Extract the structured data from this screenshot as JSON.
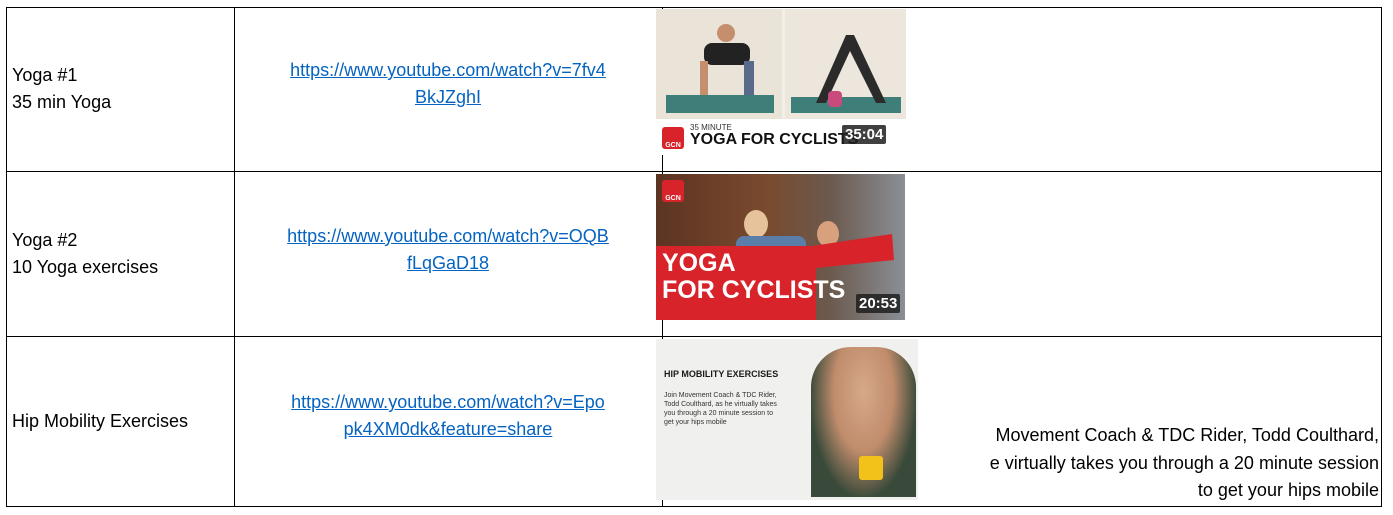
{
  "rows": [
    {
      "name_lines": [
        "Yoga #1",
        "35 min Yoga"
      ],
      "url_line1": "https://www.youtube.com/watch?v=7fv4",
      "url_line2": "BkJZghI",
      "thumbnail": {
        "logo": "GCN",
        "caption_small": "35 MINUTE",
        "caption_big": "YOGA FOR CYCLISTS",
        "duration": "35:04"
      },
      "description_lines": []
    },
    {
      "name_lines": [
        "Yoga #2",
        "10 Yoga exercises"
      ],
      "url_line1": "https://www.youtube.com/watch?v=OQB",
      "url_line2": "fLqGaD18",
      "thumbnail": {
        "logo": "GCN",
        "title_line1": "YOGA",
        "title_line2": "FOR CYCLISTS",
        "duration": "20:53"
      },
      "description_lines": []
    },
    {
      "name_lines": [
        "Hip Mobility Exercises"
      ],
      "url_line1": "https://www.youtube.com/watch?v=Epo",
      "url_line2": "pk4XM0dk&feature=share",
      "thumbnail": {
        "heading": "HIP MOBILITY EXERCISES",
        "body": "Join Movement Coach & TDC Rider, Todd Coulthard, as he virtually takes you through a 20 minute session to get your hips mobile"
      },
      "description_lines": [
        "Movement Coach & TDC Rider, Todd Coulthard,",
        "e virtually takes you through a 20 minute session",
        "to get your hips mobile"
      ]
    }
  ]
}
